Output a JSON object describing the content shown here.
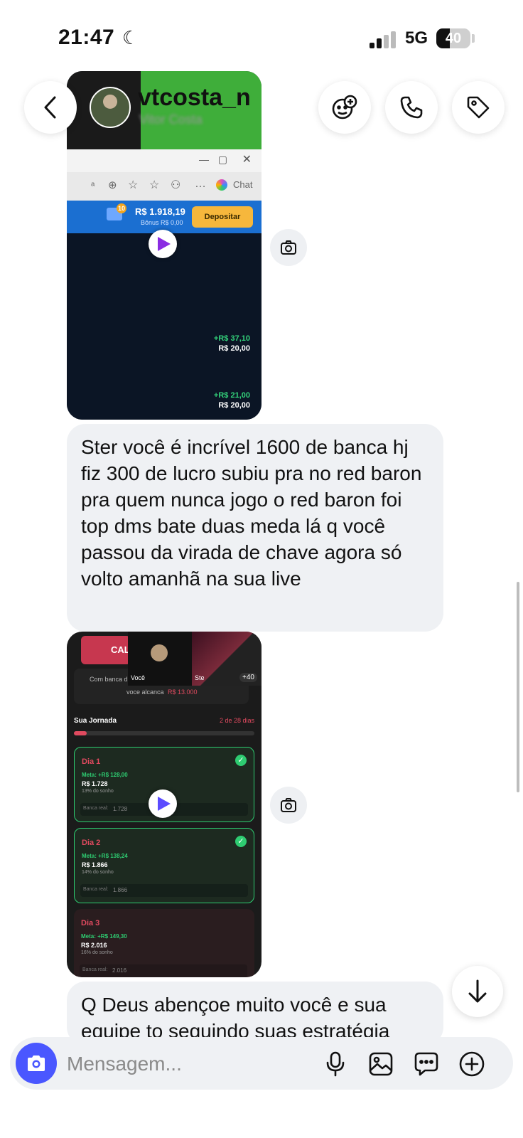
{
  "status_bar": {
    "time": "21:47",
    "network": "5G",
    "battery": "40",
    "battery_level": 0.4
  },
  "header": {
    "username": "vtcosta_n",
    "display_name": "Vitor Costa"
  },
  "media1": {
    "browser_chat_label": "Chat",
    "balance": "R$ 1.918,19",
    "bonus": "Bônus R$ 0,00",
    "deposit_button": "Depositar",
    "notif_count": "10",
    "bet1_win": "+R$ 37,10",
    "bet1_stake": "R$ 20,00",
    "bet2_win": "+R$ 21,00",
    "bet2_stake": "R$ 20,00"
  },
  "message1": "Ster você é incrível 1600 de banca hj fiz 300 de lucro subiu pra no red baron pra quem nunca jogo  o red baron foi top dms bate duas meda lá q você passou da virada de chave agora só volto amanhã na sua live",
  "media2": {
    "button_partial": "CAL",
    "call_you_label": "Você",
    "call_ster_label": "Ste",
    "call_more": "+40",
    "banca_text": "Com banca d",
    "alcanca_text": "voce alcanca",
    "alcanca_value": "R$ 13.000",
    "journey_title": "Sua Jornada",
    "journey_progress": "2 de 28 dias",
    "days": [
      {
        "title": "Dia 1",
        "meta": "Meta: +R$ 128,00",
        "amount": "R$ 1.728",
        "pct": "13% do sonho",
        "real_label": "Banca real:",
        "real_value": "1.728",
        "done": true
      },
      {
        "title": "Dia 2",
        "meta": "Meta: +R$ 138,24",
        "amount": "R$ 1.866",
        "pct": "14% do sonho",
        "real_label": "Banca real:",
        "real_value": "1.866",
        "done": true
      },
      {
        "title": "Dia 3",
        "meta": "Meta: +R$ 149,30",
        "amount": "R$ 2.016",
        "pct": "16% do sonho",
        "real_label": "Banca real:",
        "real_value": "2.016",
        "done": false
      }
    ]
  },
  "message2": "Q Deus abençoe muito você e sua equipe to seguindo suas estratégia",
  "composer": {
    "placeholder": "Mensagem..."
  }
}
